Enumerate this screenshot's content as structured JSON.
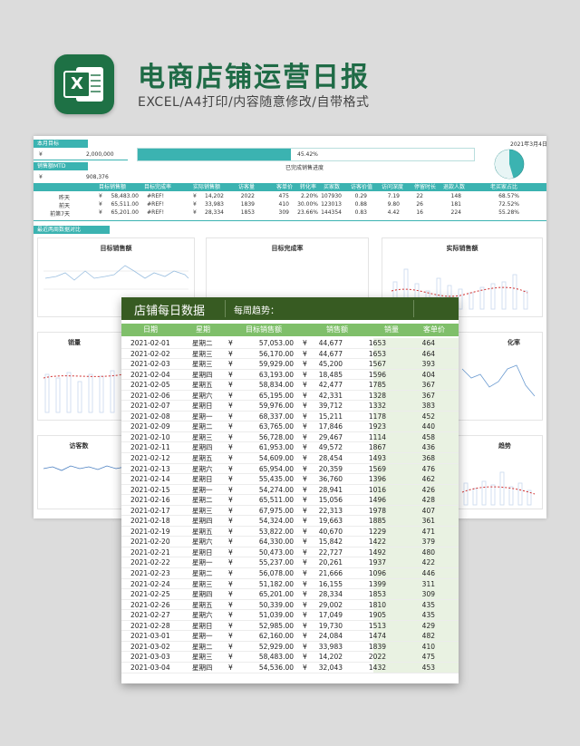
{
  "header": {
    "title": "电商店铺运营日报",
    "subtitle": "EXCEL/A4打印/内容随意修改/自带格式",
    "logo_letter": "X"
  },
  "dashboard": {
    "month_target_label": "本月目标",
    "month_target_currency": "¥",
    "month_target_value": "2,000,000",
    "sales_mtd_label": "销售额MTD",
    "sales_mtd_currency": "¥",
    "sales_mtd_value": "908,376",
    "progress_percent": 45.42,
    "progress_text": "45.42%",
    "progress_caption": "已完成销售进度",
    "date": "2021年3月4日",
    "columns": [
      "目标销售额",
      "目标完成率",
      "实际销售额",
      "访客量",
      "客单价",
      "转化率",
      "买家数",
      "访客价值",
      "访问深度",
      "停留时长",
      "退款人数",
      "老买家占比"
    ],
    "rows": [
      {
        "label": "昨天",
        "cur1": "¥",
        "v1": "58,483.00",
        "v2": "#REF!",
        "cur3": "¥",
        "v3": "14,202",
        "v4": "2022",
        "v5": "475",
        "v6": "2.20%",
        "v7": "107930",
        "v8": "0.29",
        "v9": "7.19",
        "v10": "22",
        "v11": "148",
        "v12": "68.57%"
      },
      {
        "label": "前天",
        "cur1": "¥",
        "v1": "65,511.00",
        "v2": "#REF!",
        "cur3": "¥",
        "v3": "33,983",
        "v4": "1839",
        "v5": "410",
        "v6": "30.00%",
        "v7": "123013",
        "v8": "0.88",
        "v9": "9.80",
        "v10": "26",
        "v11": "181",
        "v12": "72.52%"
      },
      {
        "label": "前第7天",
        "cur1": "¥",
        "v1": "65,201.00",
        "v2": "#REF!",
        "cur3": "¥",
        "v3": "28,334",
        "v4": "1853",
        "v5": "309",
        "v6": "23.66%",
        "v7": "144354",
        "v8": "0.83",
        "v9": "4.42",
        "v10": "16",
        "v11": "224",
        "v12": "55.28%"
      }
    ],
    "section_label": "最近两周数据对比",
    "card_titles": [
      "目标销售额",
      "目标完成率",
      "实际销售额",
      "销量",
      "化率",
      "访客数",
      "趋势"
    ]
  },
  "front": {
    "title": "店铺每日数据",
    "trend_label": "每周趋势：",
    "columns": [
      "日期",
      "星期",
      "目标销售额",
      "销售额",
      "销量",
      "客单价"
    ],
    "rows": [
      {
        "date": "2021-02-01",
        "wd": "星期二",
        "c1": "¥",
        "target": "57,053.00",
        "c2": "¥",
        "sales": "44,677",
        "qty": "1653",
        "price": "464"
      },
      {
        "date": "2021-02-02",
        "wd": "星期三",
        "c1": "¥",
        "target": "56,170.00",
        "c2": "¥",
        "sales": "44,677",
        "qty": "1653",
        "price": "464"
      },
      {
        "date": "2021-02-03",
        "wd": "星期三",
        "c1": "¥",
        "target": "59,929.00",
        "c2": "¥",
        "sales": "45,200",
        "qty": "1567",
        "price": "393"
      },
      {
        "date": "2021-02-04",
        "wd": "星期四",
        "c1": "¥",
        "target": "63,193.00",
        "c2": "¥",
        "sales": "18,485",
        "qty": "1596",
        "price": "404"
      },
      {
        "date": "2021-02-05",
        "wd": "星期五",
        "c1": "¥",
        "target": "58,834.00",
        "c2": "¥",
        "sales": "42,477",
        "qty": "1785",
        "price": "367"
      },
      {
        "date": "2021-02-06",
        "wd": "星期六",
        "c1": "¥",
        "target": "65,195.00",
        "c2": "¥",
        "sales": "42,331",
        "qty": "1328",
        "price": "367"
      },
      {
        "date": "2021-02-07",
        "wd": "星期日",
        "c1": "¥",
        "target": "59,976.00",
        "c2": "¥",
        "sales": "39,712",
        "qty": "1332",
        "price": "383"
      },
      {
        "date": "2021-02-08",
        "wd": "星期一",
        "c1": "¥",
        "target": "68,337.00",
        "c2": "¥",
        "sales": "15,211",
        "qty": "1178",
        "price": "452"
      },
      {
        "date": "2021-02-09",
        "wd": "星期二",
        "c1": "¥",
        "target": "63,765.00",
        "c2": "¥",
        "sales": "17,846",
        "qty": "1923",
        "price": "440"
      },
      {
        "date": "2021-02-10",
        "wd": "星期三",
        "c1": "¥",
        "target": "56,728.00",
        "c2": "¥",
        "sales": "29,467",
        "qty": "1114",
        "price": "458"
      },
      {
        "date": "2021-02-11",
        "wd": "星期四",
        "c1": "¥",
        "target": "61,953.00",
        "c2": "¥",
        "sales": "49,572",
        "qty": "1867",
        "price": "436"
      },
      {
        "date": "2021-02-12",
        "wd": "星期五",
        "c1": "¥",
        "target": "54,609.00",
        "c2": "¥",
        "sales": "28,454",
        "qty": "1493",
        "price": "368"
      },
      {
        "date": "2021-02-13",
        "wd": "星期六",
        "c1": "¥",
        "target": "65,954.00",
        "c2": "¥",
        "sales": "20,359",
        "qty": "1569",
        "price": "476"
      },
      {
        "date": "2021-02-14",
        "wd": "星期日",
        "c1": "¥",
        "target": "55,435.00",
        "c2": "¥",
        "sales": "36,760",
        "qty": "1396",
        "price": "462"
      },
      {
        "date": "2021-02-15",
        "wd": "星期一",
        "c1": "¥",
        "target": "54,274.00",
        "c2": "¥",
        "sales": "28,941",
        "qty": "1016",
        "price": "426"
      },
      {
        "date": "2021-02-16",
        "wd": "星期二",
        "c1": "¥",
        "target": "65,511.00",
        "c2": "¥",
        "sales": "15,056",
        "qty": "1496",
        "price": "428"
      },
      {
        "date": "2021-02-17",
        "wd": "星期三",
        "c1": "¥",
        "target": "67,975.00",
        "c2": "¥",
        "sales": "22,313",
        "qty": "1978",
        "price": "407"
      },
      {
        "date": "2021-02-18",
        "wd": "星期四",
        "c1": "¥",
        "target": "54,324.00",
        "c2": "¥",
        "sales": "19,663",
        "qty": "1885",
        "price": "361"
      },
      {
        "date": "2021-02-19",
        "wd": "星期五",
        "c1": "¥",
        "target": "53,822.00",
        "c2": "¥",
        "sales": "40,670",
        "qty": "1229",
        "price": "471"
      },
      {
        "date": "2021-02-20",
        "wd": "星期六",
        "c1": "¥",
        "target": "64,330.00",
        "c2": "¥",
        "sales": "15,842",
        "qty": "1422",
        "price": "379"
      },
      {
        "date": "2021-02-21",
        "wd": "星期日",
        "c1": "¥",
        "target": "50,473.00",
        "c2": "¥",
        "sales": "22,727",
        "qty": "1492",
        "price": "480"
      },
      {
        "date": "2021-02-22",
        "wd": "星期一",
        "c1": "¥",
        "target": "55,237.00",
        "c2": "¥",
        "sales": "20,261",
        "qty": "1937",
        "price": "422"
      },
      {
        "date": "2021-02-23",
        "wd": "星期二",
        "c1": "¥",
        "target": "56,078.00",
        "c2": "¥",
        "sales": "21,666",
        "qty": "1096",
        "price": "446"
      },
      {
        "date": "2021-02-24",
        "wd": "星期三",
        "c1": "¥",
        "target": "51,182.00",
        "c2": "¥",
        "sales": "16,155",
        "qty": "1399",
        "price": "311"
      },
      {
        "date": "2021-02-25",
        "wd": "星期四",
        "c1": "¥",
        "target": "65,201.00",
        "c2": "¥",
        "sales": "28,334",
        "qty": "1853",
        "price": "309"
      },
      {
        "date": "2021-02-26",
        "wd": "星期五",
        "c1": "¥",
        "target": "50,339.00",
        "c2": "¥",
        "sales": "29,002",
        "qty": "1810",
        "price": "435"
      },
      {
        "date": "2021-02-27",
        "wd": "星期六",
        "c1": "¥",
        "target": "51,039.00",
        "c2": "¥",
        "sales": "17,049",
        "qty": "1905",
        "price": "435"
      },
      {
        "date": "2021-02-28",
        "wd": "星期日",
        "c1": "¥",
        "target": "52,985.00",
        "c2": "¥",
        "sales": "19,730",
        "qty": "1513",
        "price": "429"
      },
      {
        "date": "2021-03-01",
        "wd": "星期一",
        "c1": "¥",
        "target": "62,160.00",
        "c2": "¥",
        "sales": "24,084",
        "qty": "1474",
        "price": "482"
      },
      {
        "date": "2021-03-02",
        "wd": "星期二",
        "c1": "¥",
        "target": "52,929.00",
        "c2": "¥",
        "sales": "33,983",
        "qty": "1839",
        "price": "410"
      },
      {
        "date": "2021-03-03",
        "wd": "星期三",
        "c1": "¥",
        "target": "58,483.00",
        "c2": "¥",
        "sales": "14,202",
        "qty": "2022",
        "price": "475"
      },
      {
        "date": "2021-03-04",
        "wd": "星期四",
        "c1": "¥",
        "target": "54,536.00",
        "c2": "¥",
        "sales": "32,043",
        "qty": "1432",
        "price": "453"
      }
    ]
  },
  "colors": {
    "brand_green": "#1f6b46",
    "teal": "#3bb3b1",
    "sheet_header": "#375b22",
    "table_header": "#7fbf6a",
    "row_shade": "#e9f2e2"
  }
}
